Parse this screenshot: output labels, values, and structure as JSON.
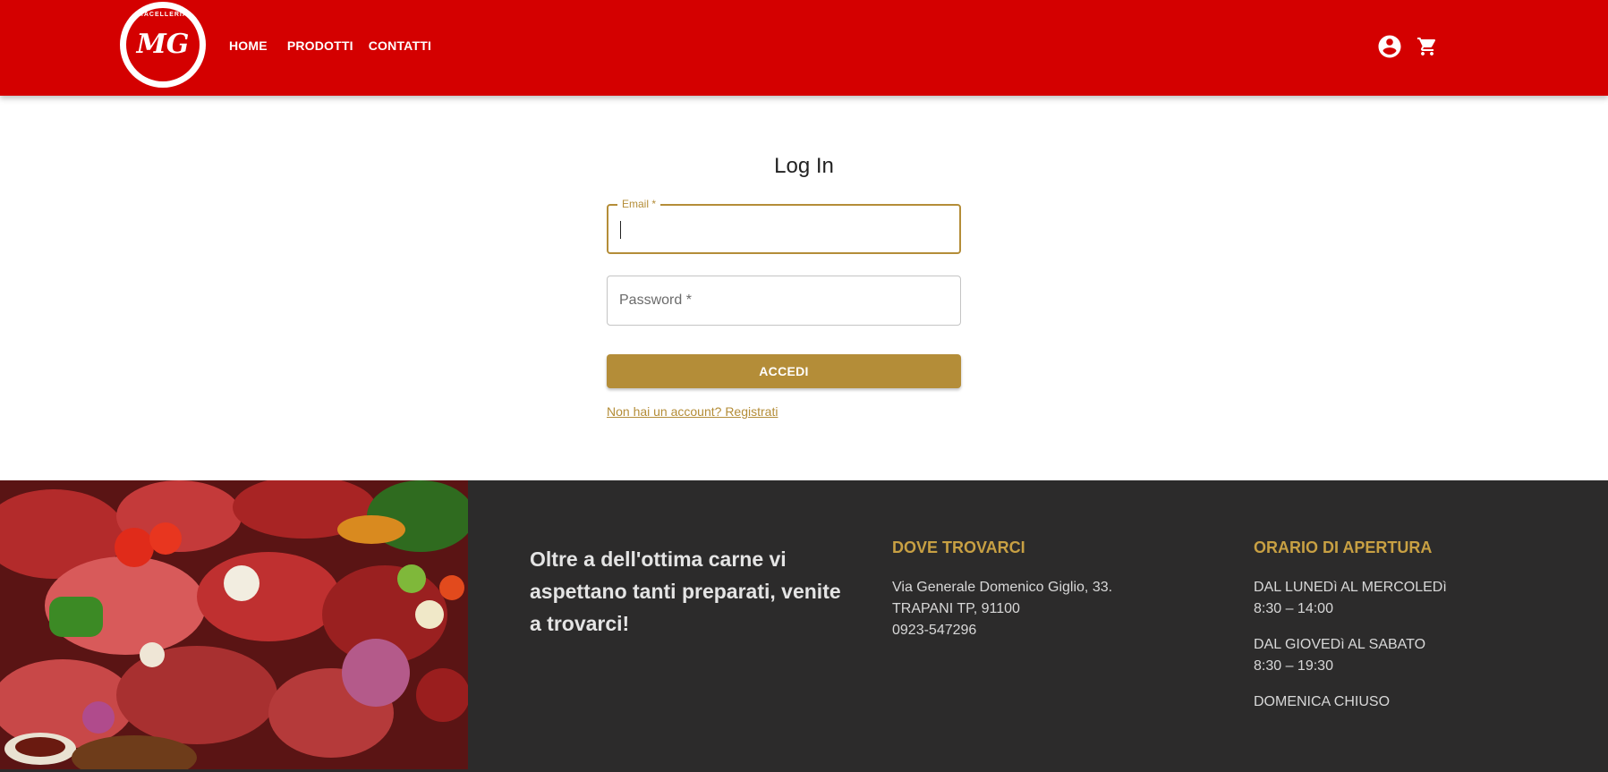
{
  "header": {
    "logo_text": "MACELLERIA",
    "logo_monogram": "MG",
    "nav": [
      {
        "label": "HOME"
      },
      {
        "label": "PRODOTTI"
      },
      {
        "label": "CONTATTI"
      }
    ],
    "icons": [
      "account-circle-icon",
      "shopping-cart-icon"
    ]
  },
  "login": {
    "title": "Log In",
    "email_label": "Email *",
    "email_value": "",
    "password_placeholder": "Password *",
    "submit_label": "ACCEDI",
    "register_link": "Non hai un account? Registrati"
  },
  "footer": {
    "tagline": "Oltre a dell'ottima carne vi aspettano tanti preparati, venite a trovarci!",
    "where": {
      "heading": "DOVE TROVARCI",
      "address": "Via Generale Domenico Giglio, 33.",
      "city": "TRAPANI TP, 91100",
      "phone": "0923-547296"
    },
    "hours": {
      "heading": "ORARIO DI APERTURA",
      "blocks": [
        {
          "days": "DAL LUNEDì AL MERCOLEDì",
          "time": "8:30 – 14:00"
        },
        {
          "days": "DAL GIOVEDì AL SABATO",
          "time": "8:30 – 19:30"
        },
        {
          "days": "DOMENICA CHIUSO"
        }
      ]
    }
  },
  "colors": {
    "header_red": "#d40000",
    "accent_gold": "#b48d38",
    "footer_bg": "#2c2b2b",
    "footer_heading": "#c8a043"
  }
}
